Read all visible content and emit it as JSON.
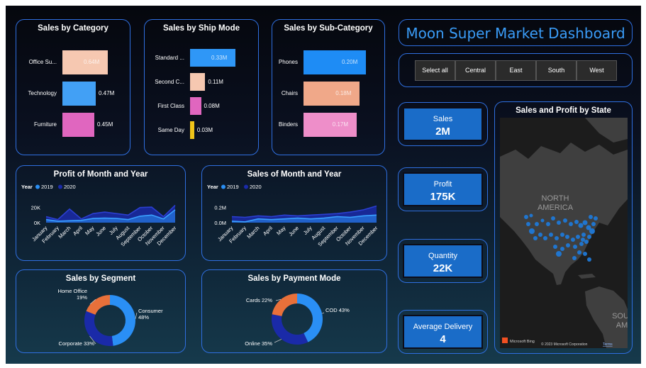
{
  "dashboard": {
    "title": "Moon Super Market Dashboard"
  },
  "region_slicer": {
    "buttons": [
      "Select all",
      "Central",
      "East",
      "South",
      "West"
    ]
  },
  "kpis": [
    {
      "label": "Sales",
      "value": "2M"
    },
    {
      "label": "Profit",
      "value": "175K"
    },
    {
      "label": "Quantity",
      "value": "22K"
    },
    {
      "label": "Average Delivery",
      "value": "4"
    }
  ],
  "sales_by_category": {
    "title": "Sales by Category",
    "items": [
      {
        "label": "Office Su...",
        "value": 0.64,
        "value_label": "0.64M",
        "color": "#f6c8b1"
      },
      {
        "label": "Technology",
        "value": 0.47,
        "value_label": "0.47M",
        "color": "#42a0f5"
      },
      {
        "label": "Furniture",
        "value": 0.45,
        "value_label": "0.45M",
        "color": "#e066bf"
      }
    ]
  },
  "sales_by_ship_mode": {
    "title": "Sales by Ship Mode",
    "items": [
      {
        "label": "Standard ...",
        "value": 0.33,
        "value_label": "0.33M",
        "color": "#2f97f7"
      },
      {
        "label": "Second C...",
        "value": 0.11,
        "value_label": "0.11M",
        "color": "#f6c8b1"
      },
      {
        "label": "First Class",
        "value": 0.08,
        "value_label": "0.08M",
        "color": "#e066bf"
      },
      {
        "label": "Same Day",
        "value": 0.03,
        "value_label": "0.03M",
        "color": "#f0c419"
      }
    ]
  },
  "sales_by_subcategory": {
    "title": "Sales by Sub-Category",
    "items": [
      {
        "label": "Phones",
        "value": 0.2,
        "value_label": "0.20M",
        "color": "#1e8cf5"
      },
      {
        "label": "Chairs",
        "value": 0.18,
        "value_label": "0.18M",
        "color": "#f0a889"
      },
      {
        "label": "Binders",
        "value": 0.17,
        "value_label": "0.17M",
        "color": "#ee8ec9"
      }
    ]
  },
  "chart_data": [
    {
      "type": "area",
      "title": "Profit of Month and Year",
      "legend_title": "Year",
      "categories": [
        "January",
        "February",
        "March",
        "April",
        "May",
        "June",
        "July",
        "August",
        "September",
        "October",
        "November",
        "December"
      ],
      "y_ticks": [
        "20K",
        "0K"
      ],
      "ylim": [
        0,
        30000
      ],
      "series": [
        {
          "name": "2019",
          "color": "#2a8ff5",
          "values": [
            4000,
            2000,
            2500,
            3000,
            5500,
            6000,
            5500,
            4000,
            8500,
            10000,
            5000,
            17000
          ]
        },
        {
          "name": "2020",
          "color": "#1a2aa8",
          "values": [
            8000,
            4000,
            18000,
            5000,
            12000,
            14000,
            12000,
            10000,
            20000,
            20500,
            8000,
            23000
          ]
        }
      ]
    },
    {
      "type": "area",
      "title": "Sales of Month and Year",
      "legend_title": "Year",
      "categories": [
        "January",
        "February",
        "March",
        "April",
        "May",
        "June",
        "July",
        "August",
        "September",
        "October",
        "November",
        "December"
      ],
      "y_ticks": [
        "0.2M",
        "0.0M"
      ],
      "ylim": [
        0,
        0.3
      ],
      "series": [
        {
          "name": "2019",
          "color": "#2a8ff5",
          "values": [
            0.02,
            0.01,
            0.05,
            0.04,
            0.05,
            0.06,
            0.05,
            0.06,
            0.08,
            0.07,
            0.09,
            0.1
          ]
        },
        {
          "name": "2020",
          "color": "#1a2aa8",
          "values": [
            0.08,
            0.07,
            0.09,
            0.08,
            0.1,
            0.09,
            0.1,
            0.11,
            0.12,
            0.14,
            0.17,
            0.22
          ]
        }
      ]
    },
    {
      "type": "pie",
      "title": "Sales by Segment",
      "slices": [
        {
          "label": "Consumer",
          "value": 48,
          "display": "Consumer\n48%",
          "color": "#2a8ff5"
        },
        {
          "label": "Corporate",
          "value": 33,
          "display": "Corporate 33%",
          "color": "#1a2aa8"
        },
        {
          "label": "Home Office",
          "value": 19,
          "display": "Home Office\n19%",
          "color": "#e8703a"
        }
      ]
    },
    {
      "type": "pie",
      "title": "Sales by Payment Mode",
      "slices": [
        {
          "label": "COD",
          "value": 43,
          "display": "COD 43%",
          "color": "#2a8ff5"
        },
        {
          "label": "Online",
          "value": 35,
          "display": "Online 35%",
          "color": "#1a2aa8"
        },
        {
          "label": "Cards",
          "value": 22,
          "display": "Cards 22%",
          "color": "#e8703a"
        }
      ]
    }
  ],
  "map": {
    "title": "Sales and Profit by State",
    "labels": {
      "north_america_1": "NORTH",
      "north_america_2": "AMERICA",
      "south_1": "SOU",
      "south_2": "AM"
    },
    "attribution_brand": "Microsoft Bing",
    "attribution_copyright": "© 2023 Microsoft Corporation",
    "attribution_terms": "Terms"
  }
}
